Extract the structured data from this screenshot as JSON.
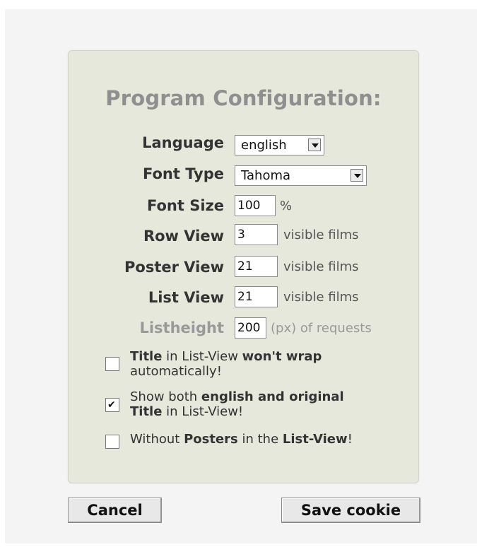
{
  "dialog": {
    "title": "Program Configuration:"
  },
  "fields": {
    "language": {
      "label": "Language",
      "value": "english"
    },
    "font_type": {
      "label": "Font Type",
      "value": "Tahoma"
    },
    "font_size": {
      "label": "Font Size",
      "value": "100",
      "suffix": "%"
    },
    "row_view": {
      "label": "Row View",
      "value": "3",
      "suffix": "visible films"
    },
    "poster_view": {
      "label": "Poster View",
      "value": "21",
      "suffix": "visible films"
    },
    "list_view": {
      "label": "List View",
      "value": "21",
      "suffix": "visible films"
    },
    "listheight": {
      "label": "Listheight",
      "value": "200",
      "suffix": "(px) of requests"
    }
  },
  "options": {
    "no_wrap": {
      "checked": false,
      "part1_bold": "Title",
      "part2": " in List-View ",
      "part3_bold": "won't wrap",
      "line2": "automatically!"
    },
    "show_both_titles": {
      "checked": true,
      "part1": "Show both ",
      "part2_bold": "english and original",
      "line2_bold": "Title",
      "line2_rest": " in List-View!"
    },
    "without_posters": {
      "checked": false,
      "part1": "Without ",
      "part2_bold": "Posters",
      "part3": " in the ",
      "part4_bold": "List-View",
      "part5": "!"
    }
  },
  "buttons": {
    "cancel": "Cancel",
    "save": "Save cookie"
  }
}
